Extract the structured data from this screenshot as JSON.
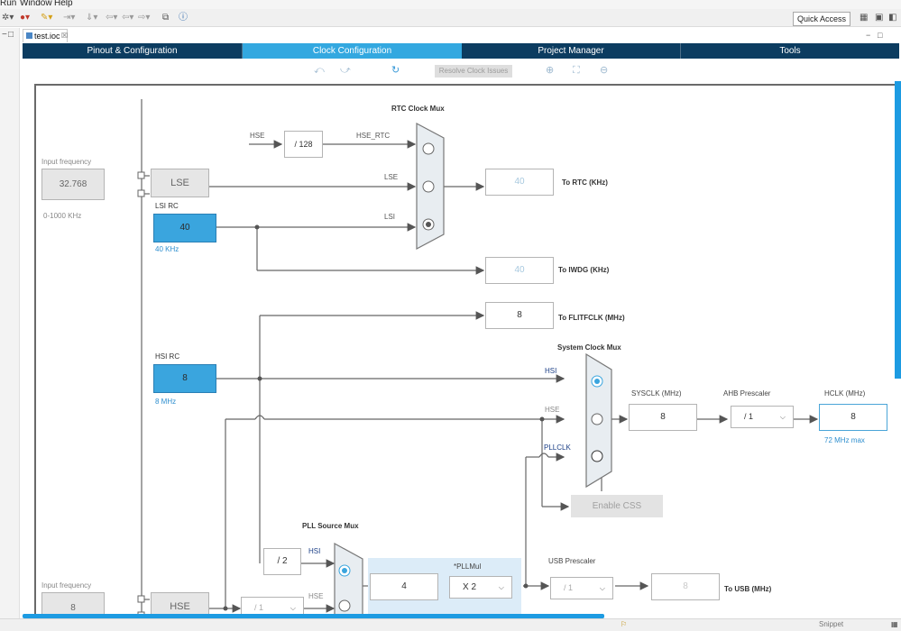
{
  "menu": {
    "run": "Run",
    "window": "Window",
    "help": "Help"
  },
  "toolbar": {
    "quick_access": "Quick Access"
  },
  "editor_tab": {
    "label": "test.ioc",
    "close": "☒"
  },
  "main_tabs": [
    {
      "label": "Pinout & Configuration"
    },
    {
      "label": "Clock Configuration"
    },
    {
      "label": "Project Manager"
    },
    {
      "label": "Tools"
    }
  ],
  "subtoolbar": {
    "resolve_label": "Resolve Clock Issues"
  },
  "diagram": {
    "input_freq_top": {
      "label": "Input frequency",
      "value": "32.768",
      "range": "0-1000 KHz"
    },
    "lse_label": "LSE",
    "lsi": {
      "title": "LSI RC",
      "value": "40",
      "unit": "40 KHz"
    },
    "rtc_mux_title": "RTC Clock Mux",
    "hse_in_label": "HSE",
    "div128": "/ 128",
    "hse_rtc_label": "HSE_RTC",
    "lse_wire": "LSE",
    "lsi_wire": "LSI",
    "rtc_out": {
      "value": "40",
      "label": "To RTC (KHz)"
    },
    "iwdg_out": {
      "value": "40",
      "label": "To IWDG (KHz)"
    },
    "flitf_out": {
      "value": "8",
      "label": "To FLITFCLK (MHz)"
    },
    "hsi": {
      "title": "HSI RC",
      "value": "8",
      "unit": "8 MHz"
    },
    "sys_mux_title": "System Clock Mux",
    "sys_hsi": "HSI",
    "sys_hse": "HSE",
    "sys_pllclk": "PLLCLK",
    "sysclk": {
      "label": "SYSCLK (MHz)",
      "value": "8"
    },
    "ahb": {
      "label": "AHB Prescaler",
      "value": "/ 1"
    },
    "hclk": {
      "label": "HCLK (MHz)",
      "value": "8",
      "max": "72 MHz max"
    },
    "enable_css": "Enable CSS",
    "pll_src_title": "PLL Source Mux",
    "div2": "/ 2",
    "pll_hsi": "HSI",
    "pll_hse": "HSE",
    "pll_val": "4",
    "pllmul": {
      "label": "*PLLMul",
      "value": "X 2"
    },
    "usb_pre": {
      "label": "USB Prescaler",
      "value": "/ 1"
    },
    "usb_out": {
      "value": "8",
      "label": "To USB (MHz)"
    },
    "input_freq_bottom": {
      "label": "Input frequency",
      "value": "8"
    },
    "hse_block": "HSE",
    "hse_div_value": "/ 1"
  },
  "status": {
    "right_text": "Snippet"
  },
  "colors": {
    "accent": "#33a8e0",
    "nav_bg": "#0c3c60",
    "block_blue": "#3aa5de"
  },
  "icons": [
    "undo-icon",
    "redo-icon",
    "refresh-icon",
    "zoom-in-icon",
    "fit-icon",
    "zoom-out-icon"
  ]
}
